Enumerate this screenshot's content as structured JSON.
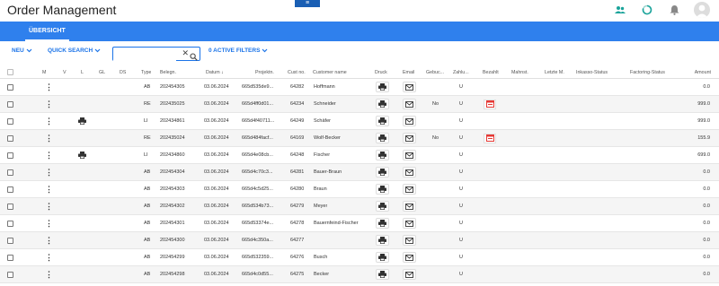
{
  "app": {
    "title": "Order Management",
    "menu_handle": "≡"
  },
  "tabs": [
    {
      "label": "ÜBERSICHT"
    }
  ],
  "toolbar": {
    "new_label": "NEU",
    "quick_search_label": "QUICK SEARCH",
    "search_value": "",
    "search_placeholder": "",
    "filters_label": "0 ACTIVE FILTERS"
  },
  "columns": {
    "m": "M",
    "v": "V",
    "l": "L",
    "gl": "GL",
    "ds": "DS",
    "type": "Type",
    "belegnr": "Belegn.",
    "datum": "Datum ↓",
    "projekt": "Projektn.",
    "custno": "Cust no.",
    "custname": "Customer name",
    "druck": "Druck",
    "email": "Email",
    "gebuch": "Gebuc...",
    "zahl": "Zahlu...",
    "bezahlt": "Bezahlt",
    "mahnst": "Mahnst.",
    "letzte": "Letzte M.",
    "inkasso": "Inkasso-Status",
    "factoring": "Factoring-Status",
    "amount": "Amount"
  },
  "rows": [
    {
      "l_print": false,
      "type": "AB",
      "belegnr": "202454305",
      "datum": "03.06.2024",
      "projekt": "665d535de9...",
      "custno": "64282",
      "custname": "Hoffmann",
      "gebuch": "",
      "zahl": "U",
      "bezahlt": false,
      "amount": "0.0"
    },
    {
      "l_print": false,
      "type": "RE",
      "belegnr": "202435025",
      "datum": "03.06.2024",
      "projekt": "665d4ff0d01...",
      "custno": "64234",
      "custname": "Schneider",
      "gebuch": "No",
      "zahl": "U",
      "bezahlt": true,
      "amount": "999.0"
    },
    {
      "l_print": true,
      "type": "LI",
      "belegnr": "202434861",
      "datum": "03.06.2024",
      "projekt": "665d4f40711...",
      "custno": "64249",
      "custname": "Schäfer",
      "gebuch": "",
      "zahl": "U",
      "bezahlt": false,
      "amount": "999.0"
    },
    {
      "l_print": false,
      "type": "RE",
      "belegnr": "202435024",
      "datum": "03.06.2024",
      "projekt": "665d484facf...",
      "custno": "64169",
      "custname": "Wolf-Becker",
      "gebuch": "No",
      "zahl": "U",
      "bezahlt": true,
      "amount": "155.9"
    },
    {
      "l_print": true,
      "type": "LI",
      "belegnr": "202434860",
      "datum": "03.06.2024",
      "projekt": "665d4e08cb...",
      "custno": "64248",
      "custname": "Fischer",
      "gebuch": "",
      "zahl": "U",
      "bezahlt": false,
      "amount": "699.0"
    },
    {
      "l_print": false,
      "type": "AB",
      "belegnr": "202454304",
      "datum": "03.06.2024",
      "projekt": "665d4c70c3...",
      "custno": "64281",
      "custname": "Bauer-Braun",
      "gebuch": "",
      "zahl": "U",
      "bezahlt": false,
      "amount": "0.0"
    },
    {
      "l_print": false,
      "type": "AB",
      "belegnr": "202454303",
      "datum": "03.06.2024",
      "projekt": "665d4c5d25...",
      "custno": "64280",
      "custname": "Braun",
      "gebuch": "",
      "zahl": "U",
      "bezahlt": false,
      "amount": "0.0"
    },
    {
      "l_print": false,
      "type": "AB",
      "belegnr": "202454302",
      "datum": "03.06.2024",
      "projekt": "665d534b73...",
      "custno": "64279",
      "custname": "Meyer",
      "gebuch": "",
      "zahl": "U",
      "bezahlt": false,
      "amount": "0.0"
    },
    {
      "l_print": false,
      "type": "AB",
      "belegnr": "202454301",
      "datum": "03.06.2024",
      "projekt": "665d53374e...",
      "custno": "64278",
      "custname": "Bauernfeind-Fischer",
      "gebuch": "",
      "zahl": "U",
      "bezahlt": false,
      "amount": "0.0"
    },
    {
      "l_print": false,
      "type": "AB",
      "belegnr": "202454300",
      "datum": "03.06.2024",
      "projekt": "665d4c350a...",
      "custno": "64277",
      "custname": "",
      "gebuch": "",
      "zahl": "U",
      "bezahlt": false,
      "amount": "0.0"
    },
    {
      "l_print": false,
      "type": "AB",
      "belegnr": "202454299",
      "datum": "03.06.2024",
      "projekt": "665d532359...",
      "custno": "64276",
      "custname": "Busch",
      "gebuch": "",
      "zahl": "U",
      "bezahlt": false,
      "amount": "0.0"
    },
    {
      "l_print": false,
      "type": "AB",
      "belegnr": "202454298",
      "datum": "03.06.2024",
      "projekt": "665d4c0d55...",
      "custno": "64275",
      "custname": "Becker",
      "gebuch": "",
      "zahl": "U",
      "bezahlt": false,
      "amount": "0.0"
    }
  ],
  "icons": {
    "users": "users-icon",
    "refresh": "refresh-icon",
    "bell": "bell-icon",
    "avatar": "avatar",
    "print": "printer-icon",
    "email": "envelope-icon",
    "bezahlt": "invoice-icon"
  },
  "colors": {
    "accent": "#2f80ed",
    "link": "#1a73e8",
    "teal": "#1aa39a",
    "bezahlt": "#e53935"
  }
}
